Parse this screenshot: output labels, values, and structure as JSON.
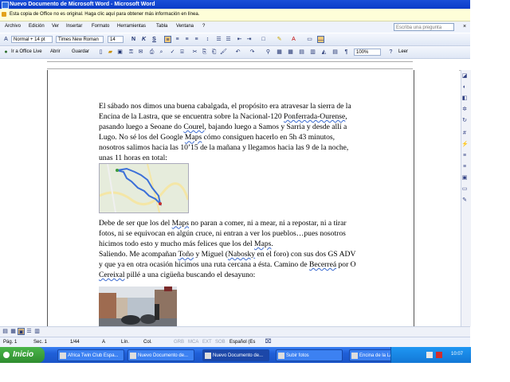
{
  "window": {
    "title": "Nuevo Documento de Microsoft Word - Microsoft Word"
  },
  "notice": {
    "text": "Esta copia de Office no es original. Haga clic aquí para obtener más información en línea."
  },
  "menu": {
    "items": [
      "Archivo",
      "Edición",
      "Ver",
      "Insertar",
      "Formato",
      "Herramientas",
      "Tabla",
      "Ventana",
      "?"
    ],
    "help_placeholder": "Escriba una pregunta",
    "doc_close": "×"
  },
  "toolbar1": {
    "style": "Normal + 14 pt",
    "font": "Times New Roman",
    "size": "14",
    "bold": "N",
    "italic": "K",
    "underline": "S"
  },
  "toolbar2": {
    "office_live": "Ir a Office Live",
    "open": "Abrir",
    "save": "Guardar",
    "zoom": "100%",
    "read": "Leer"
  },
  "document": {
    "p1": [
      {
        "t": "El sábado nos dimos una buena cabalgada, el propósito era atravesar la sierra de la Encina de la Lastra, que se encuentra sobre la Nacional-120 "
      },
      {
        "t": "Ponferrada-Ourense",
        "u": true
      },
      {
        "t": ", pasando luego a Seoane do "
      },
      {
        "t": "Courel",
        "u": true
      },
      {
        "t": ", bajando luego a Samos y Sarria y desde allí a Lugo. No sé los del Google "
      },
      {
        "t": "Maps",
        "u": true
      },
      {
        "t": " cómo consiguen hacerlo en 5h 43 minutos, nosotros salimos hacia las 10’15 de la mañana y llegamos hacia las 9 de la noche, unas 11 horas en total:"
      }
    ],
    "p2": [
      {
        "t": "Debe de ser que los del "
      },
      {
        "t": "Maps",
        "u": true
      },
      {
        "t": " no paran a comer, ni a mear, ni a repostar, ni a tirar fotos, ni se equivocan en algún cruce, ni entran a ver los pueblos…pues nosotros hicimos todo esto y mucho más felices que los del "
      },
      {
        "t": "Maps",
        "u": true
      },
      {
        "t": "."
      }
    ],
    "p3": [
      {
        "t": "Saliendo. Me acompañan "
      },
      {
        "t": "Toño",
        "u": true
      },
      {
        "t": " y Miguel ("
      },
      {
        "t": "Nabosky",
        "u": true
      },
      {
        "t": " en el foro) con sus dos GS ADV y que ya en otra ocasión hicimos una ruta cercana a ésta. Camino de "
      },
      {
        "t": "Becerreá",
        "u": true
      },
      {
        "t": " por O "
      },
      {
        "t": "Cereixal",
        "u": true
      },
      {
        "t": " pillé a una cigüeña buscando el desayuno:"
      }
    ]
  },
  "status": {
    "page": "Pág. 1",
    "section": "Sec. 1",
    "pages": "1/44",
    "at": "A",
    "line": "Lín.",
    "col": "Col.",
    "grb": "GRB",
    "mca": "MCA",
    "ext": "EXT",
    "sob": "SOB",
    "lang": "Español (Es"
  },
  "taskbar": {
    "start": "Inicio",
    "tasks": [
      "Africa Twin Club Espa...",
      "Nuevo Documento de...",
      "Nuevo Documento de...",
      "Subir fotos",
      "Encina de la Lastra"
    ],
    "clock": "10:07"
  }
}
